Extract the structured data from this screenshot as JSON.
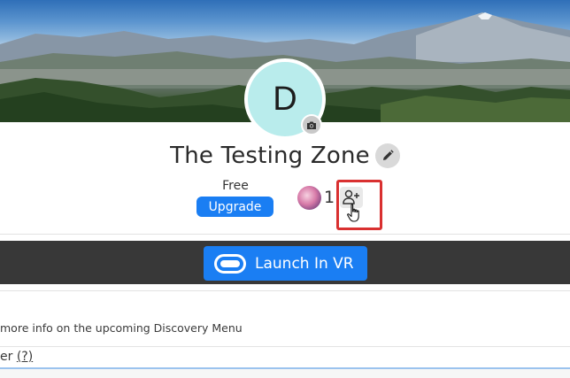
{
  "banner": {
    "description_icon": "mountain-landscape"
  },
  "profile": {
    "avatar_letter": "D",
    "title": "The Testing Zone"
  },
  "plan": {
    "label": "Free",
    "upgrade_label": "Upgrade"
  },
  "members": {
    "count": "1"
  },
  "vr": {
    "launch_label": "Launch In VR"
  },
  "info": {
    "text": "more info on the upcoming Discovery Menu"
  },
  "field": {
    "prefix": "er",
    "help_label": "(?)"
  },
  "colors": {
    "accent": "#1a7ef3",
    "highlight": "#d93030",
    "dark_bar": "#383838",
    "avatar_bg": "#b9ecec"
  },
  "icons": {
    "camera": "camera-icon",
    "edit": "pencil-icon",
    "add_member": "add-person-icon",
    "vr": "vr-headset-icon",
    "cursor": "hand-pointer-icon"
  }
}
